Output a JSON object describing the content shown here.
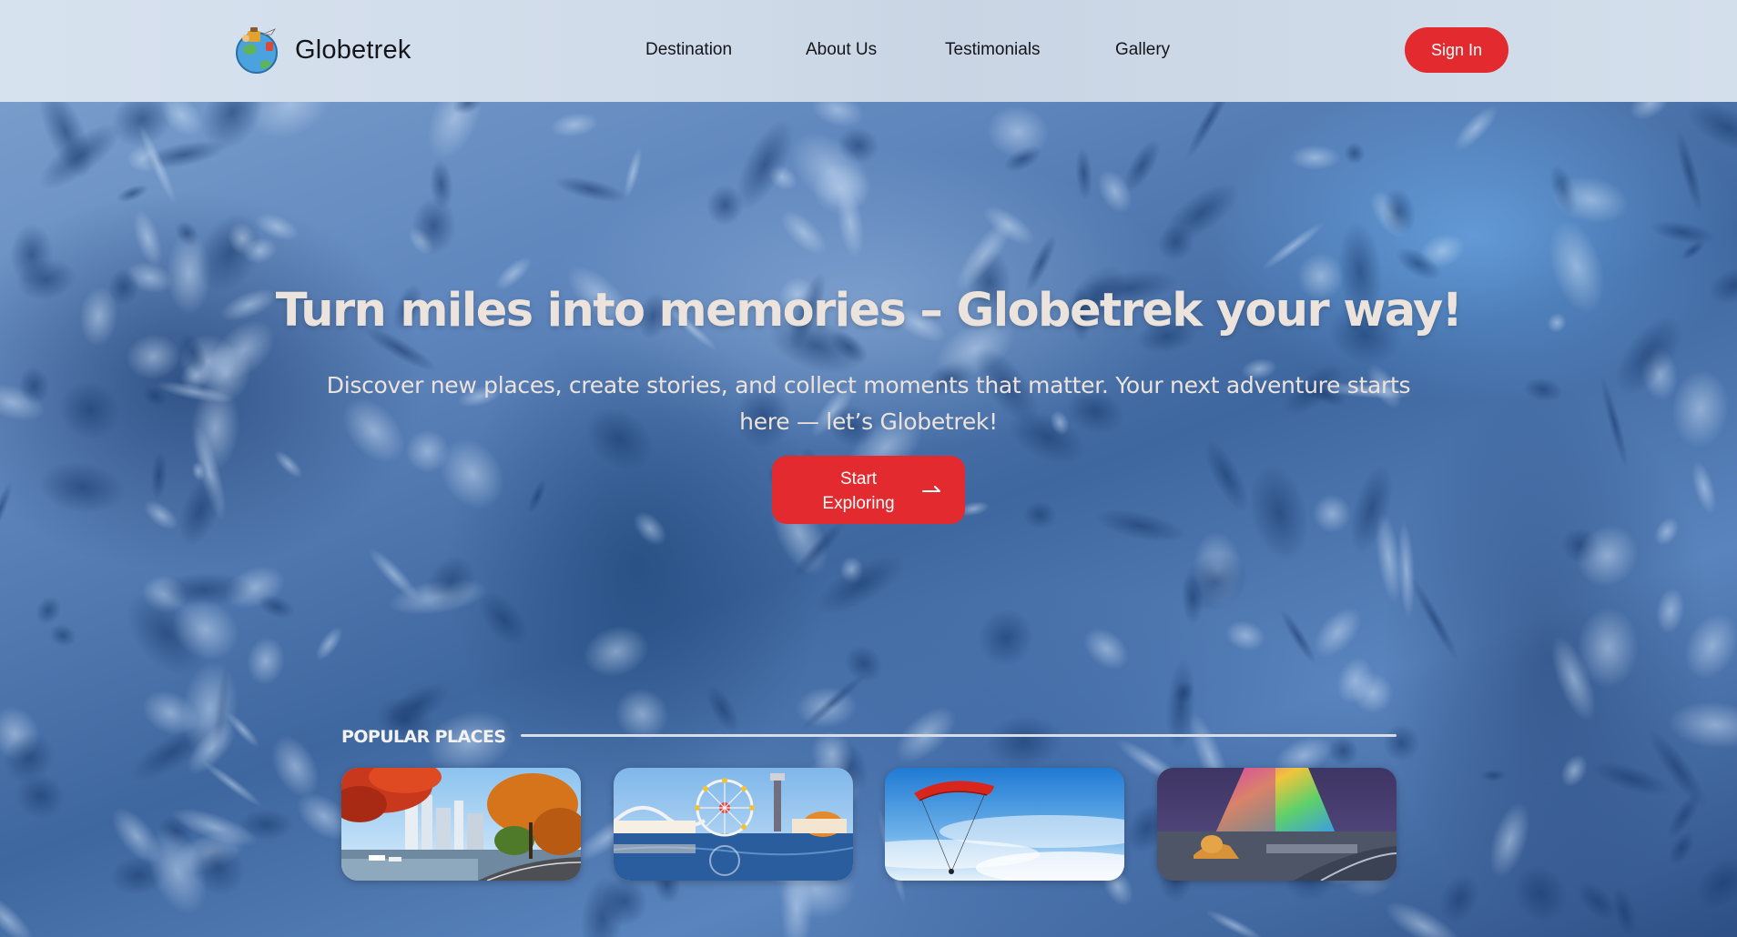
{
  "app": {
    "brand_name": "Globetrek",
    "logo_icon": "globe-traveler-logo-icon"
  },
  "nav": {
    "links": [
      {
        "label": "Destination"
      },
      {
        "label": "About Us"
      },
      {
        "label": "Testimonials"
      },
      {
        "label": "Gallery"
      }
    ],
    "signin_label": "Sign In"
  },
  "hero": {
    "title": "Turn miles into memories – Globetrek your way!",
    "subtitle": "Discover new places, create stories, and collect moments that matter. Your next adventure starts here — let’s Globetrek!",
    "cta_label": "Start Exploring",
    "cta_icon": "arrow-right-icon"
  },
  "popular": {
    "heading": "POPULAR PLACES",
    "places": [
      {
        "image": "autumn-city-harbor-image"
      },
      {
        "image": "amusement-park-ferris-wheel-image"
      },
      {
        "image": "paragliding-sky-image"
      },
      {
        "image": "illuminated-pyramid-sphinx-image"
      }
    ]
  },
  "colors": {
    "accent": "#e32a2e",
    "navbar_bg": "#d0dbe9",
    "hero_text": "#ece3dc"
  }
}
